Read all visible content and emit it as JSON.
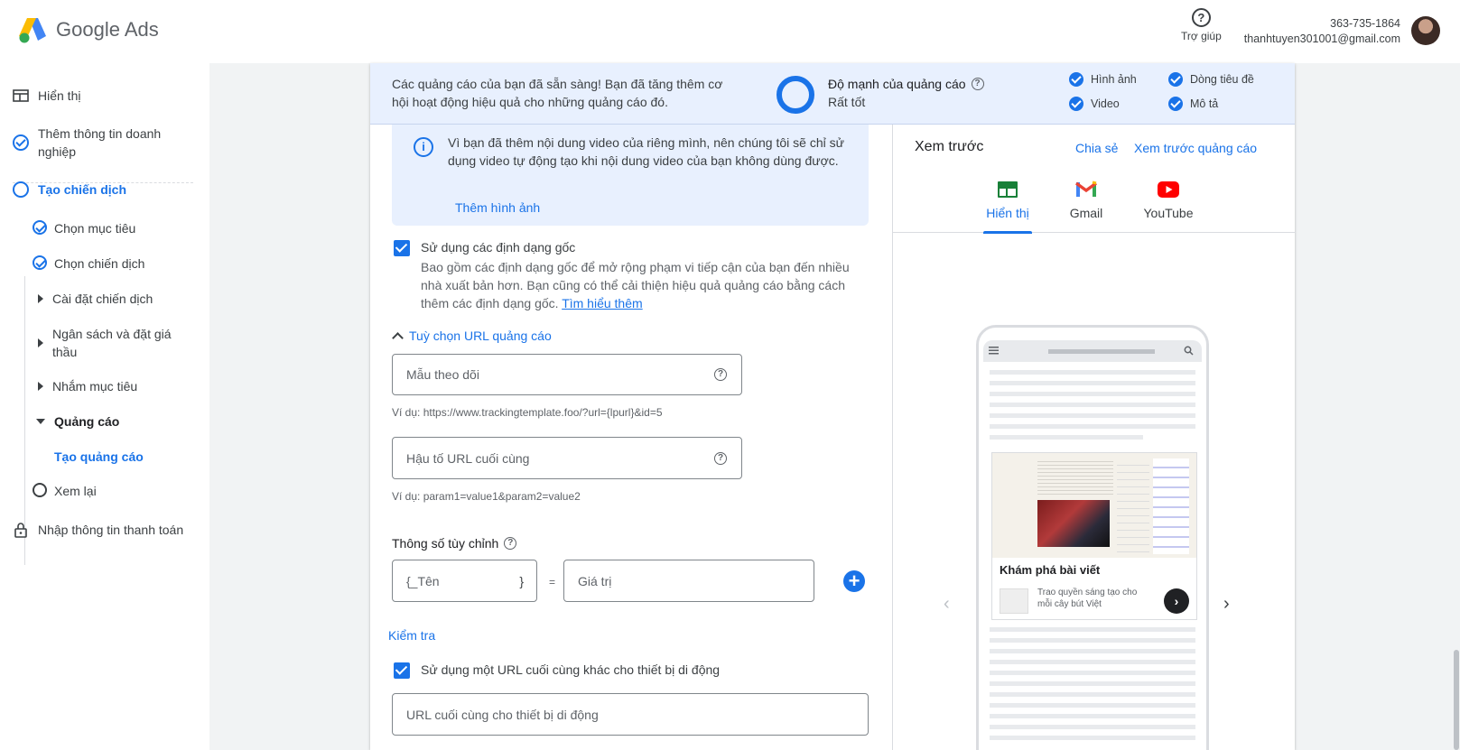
{
  "header": {
    "app_name": "Google Ads",
    "help_label": "Trợ giúp",
    "phone": "363-735-1864",
    "email": "thanhtuyen301001@gmail.com"
  },
  "sidebar": {
    "items": [
      {
        "label": "Hiển thị",
        "icon": "layout-icon"
      },
      {
        "label": "Thêm thông tin doanh nghiệp",
        "icon": "check-circle-icon"
      },
      {
        "label": "Tạo chiến dịch",
        "icon": "empty-circle-icon"
      },
      {
        "label": "Chọn mục tiêu",
        "icon": "check-circle-icon"
      },
      {
        "label": "Chọn chiến dịch",
        "icon": "check-circle-icon"
      },
      {
        "label": "Cài đặt chiến dịch",
        "icon": "expand-right-icon"
      },
      {
        "label": "Ngân sách và đặt giá thầu",
        "icon": "expand-right-icon"
      },
      {
        "label": "Nhắm mục tiêu",
        "icon": "expand-right-icon"
      },
      {
        "label": "Quảng cáo",
        "icon": "expand-down-icon"
      },
      {
        "label": "Tạo quảng cáo",
        "icon": ""
      },
      {
        "label": "Xem lại",
        "icon": "empty-circle-icon"
      },
      {
        "label": "Nhập thông tin thanh toán",
        "icon": "lock-icon"
      }
    ]
  },
  "banner": {
    "message": "Các quảng cáo của bạn đã sẵn sàng! Bạn đã tăng thêm cơ hội hoạt động hiệu quả cho những quảng cáo đó.",
    "strength_title": "Độ mạnh của quảng cáo",
    "strength_value": "Rất tốt",
    "assets": [
      "Hình ảnh",
      "Dòng tiêu đề",
      "Video",
      "Mô tả"
    ]
  },
  "info": {
    "text": "Vì bạn đã thêm nội dung video của riêng mình, nên chúng tôi sẽ chỉ sử dụng video tự động tạo khi nội dung video của bạn không dùng được.",
    "link": "Thêm hình ảnh"
  },
  "native_formats": {
    "label": "Sử dụng các định dạng gốc",
    "description": "Bao gồm các định dạng gốc để mở rộng phạm vi tiếp cận của bạn đến nhiều nhà xuất bản hơn. Bạn cũng có thể cải thiện hiệu quả quảng cáo bằng cách thêm các định dạng gốc.",
    "learn_more": "Tìm hiểu thêm"
  },
  "url_options": {
    "toggle_label": "Tuỳ chọn URL quảng cáo",
    "tracking_placeholder": "Mẫu theo dõi",
    "tracking_hint": "Ví dụ: https://www.trackingtemplate.foo/?url={lpurl}&id=5",
    "suffix_placeholder": "Hậu tố URL cuối cùng",
    "suffix_hint": "Ví dụ: param1=value1&param2=value2",
    "custom_params_title": "Thông số tùy chỉnh",
    "name_placeholder": "{_Tên",
    "brace_close": "}",
    "equals": "=",
    "value_placeholder": "Giá trị",
    "test_link": "Kiểm tra",
    "mobile_checkbox": "Sử dụng một URL cuối cùng khác cho thiết bị di động",
    "mobile_placeholder": "URL cuối cùng cho thiết bị di động"
  },
  "preview": {
    "title": "Xem trước",
    "share": "Chia sẻ",
    "preview_ad": "Xem trước quảng cáo",
    "tabs": [
      "Hiển thị",
      "Gmail",
      "YouTube"
    ],
    "ad_title": "Khám phá bài viết",
    "ad_desc": "Trao quyền sáng tạo cho mỗi cây bút Việt"
  },
  "colors": {
    "accent": "#1a73e8",
    "banner_bg": "#e8f0fe"
  }
}
